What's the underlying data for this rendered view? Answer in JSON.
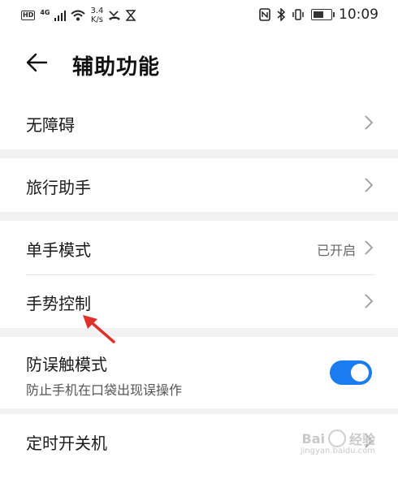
{
  "status_bar": {
    "hd": "HD",
    "network": "4G",
    "speed_value": "3.4",
    "speed_unit": "K/s",
    "time": "10:09",
    "battery_level": 0.62
  },
  "header": {
    "title": "辅助功能"
  },
  "items": [
    {
      "label": "无障碍"
    },
    {
      "label": "旅行助手"
    },
    {
      "label": "单手模式",
      "value": "已开启"
    },
    {
      "label": "手势控制"
    },
    {
      "label": "防误触模式",
      "sublabel": "防止手机在口袋出现误操作",
      "toggle_on": true
    },
    {
      "label": "定时开关机"
    }
  ],
  "colors": {
    "accent": "#1a7cf0",
    "annotation_arrow": "#e0302a",
    "group_separator": "#f2f2f2"
  },
  "watermark": {
    "brand": "Bai",
    "suffix": "经验",
    "url": "jingyan.baidu.com"
  }
}
